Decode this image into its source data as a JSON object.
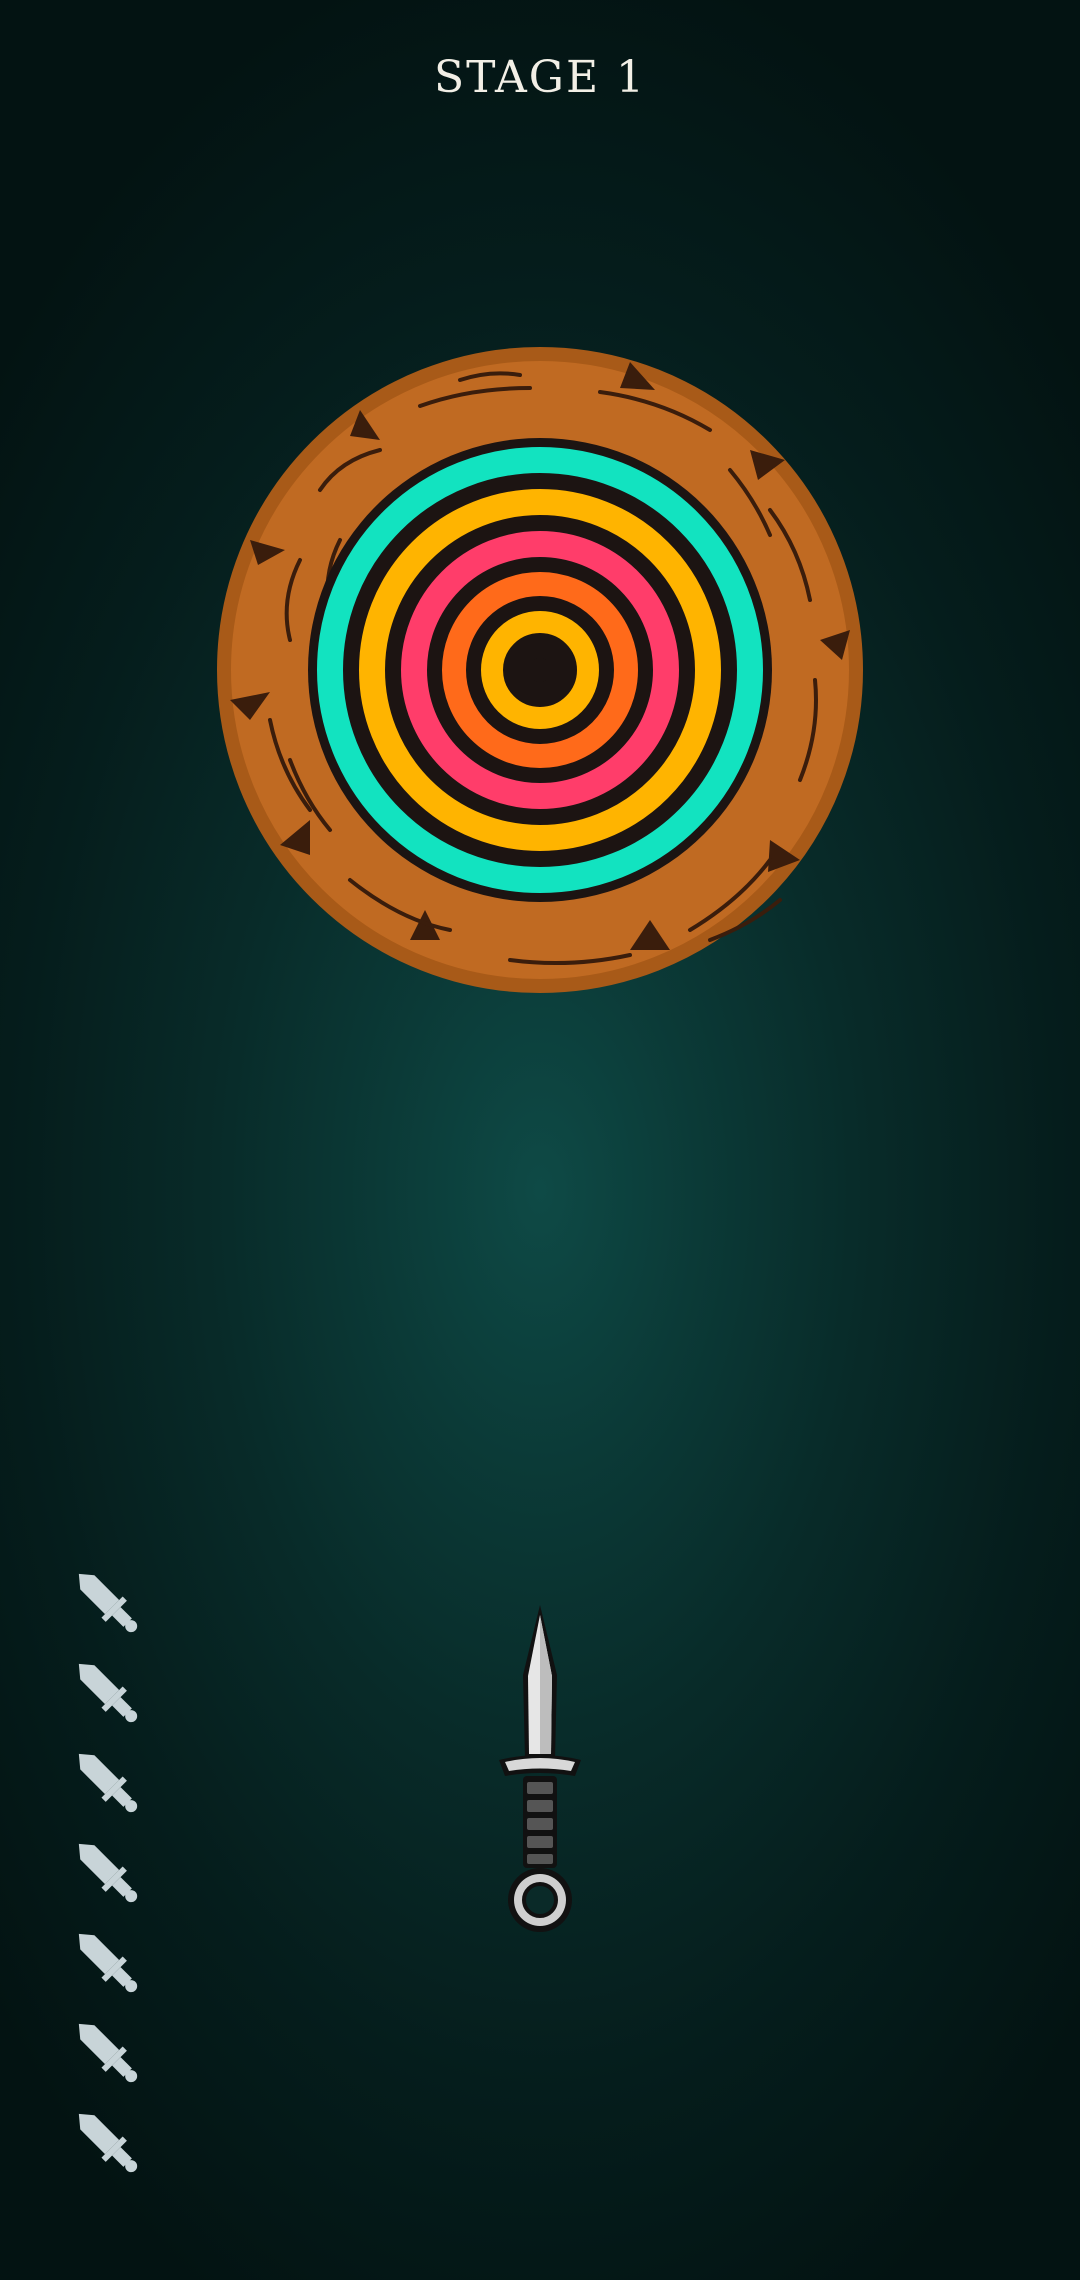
{
  "hud": {
    "stage_label": "STAGE 1"
  },
  "knives_remaining": 7,
  "colors": {
    "background_center": "#0e4a46",
    "background_edge": "#031312",
    "wood": "#c06a22",
    "wood_dark": "#3a1d0c",
    "spiral": [
      "#12e3c0",
      "#ffb400",
      "#ff3d6a",
      "#ff6a1a",
      "#ffb400"
    ],
    "knife_icon": "#c8d4d8"
  },
  "icons": {
    "target": "wooden-log-target-icon",
    "stock_knife": "knife-icon",
    "player_knife": "dagger-icon"
  }
}
